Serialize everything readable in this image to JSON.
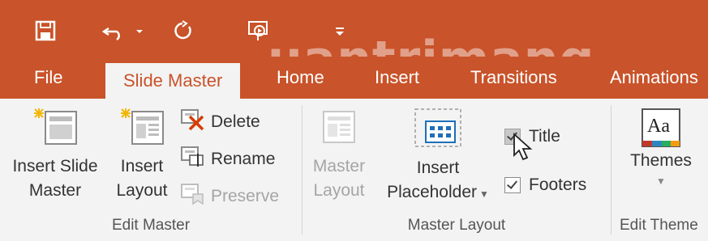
{
  "quick_access": {
    "icons": [
      "save-icon",
      "undo-icon",
      "redo-icon",
      "slideshow-icon",
      "customize-icon"
    ]
  },
  "tabs": [
    {
      "label": "File"
    },
    {
      "label": "Slide Master"
    },
    {
      "label": "Home"
    },
    {
      "label": "Insert"
    },
    {
      "label": "Transitions"
    },
    {
      "label": "Animations"
    }
  ],
  "watermark": "uantrimang",
  "groups": {
    "edit_master": {
      "label": "Edit Master",
      "insert_slide_master": [
        "Insert Slide",
        "Master"
      ],
      "insert_layout": [
        "Insert",
        "Layout"
      ],
      "delete": "Delete",
      "rename": "Rename",
      "preserve": "Preserve"
    },
    "master_layout": {
      "label": "Master Layout",
      "master_layout": [
        "Master",
        "Layout"
      ],
      "insert_placeholder": [
        "Insert",
        "Placeholder"
      ],
      "title_checkbox": {
        "label": "Title",
        "checked": true,
        "disabled": true
      },
      "footers_checkbox": {
        "label": "Footers",
        "checked": true
      }
    },
    "edit_theme": {
      "label": "Edit Theme",
      "themes": "Themes",
      "theme_icon_text": "Aa"
    }
  },
  "colors": {
    "accent": "#c9532a",
    "ribbon_bg": "#f3f3f3"
  }
}
